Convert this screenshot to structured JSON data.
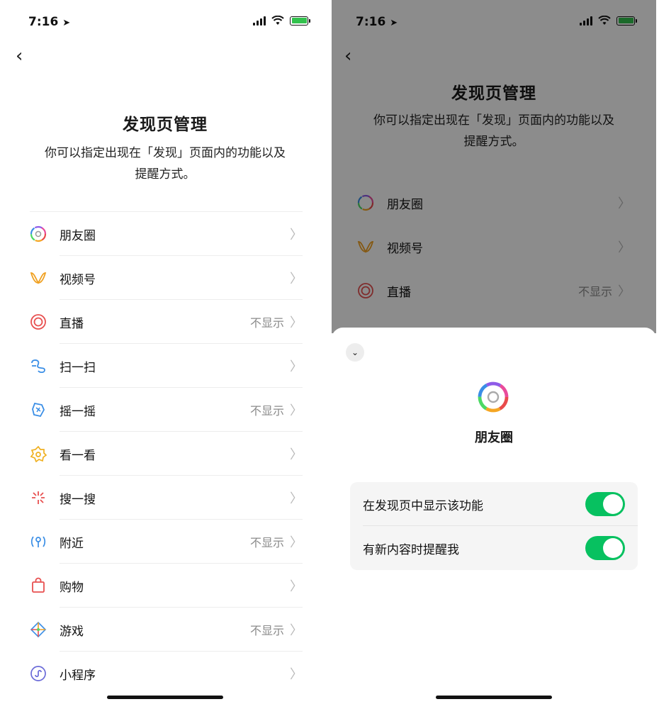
{
  "status_bar": {
    "time": "7:16",
    "battery_color": "#32c24d"
  },
  "page": {
    "title": "发现页管理",
    "subtitle_line1": "你可以指定出现在「发现」页面内的功能以及",
    "subtitle_line2": "提醒方式。"
  },
  "list": [
    {
      "label": "朋友圈",
      "value": "",
      "icon": "moments-icon"
    },
    {
      "label": "视频号",
      "value": "",
      "icon": "channels-icon"
    },
    {
      "label": "直播",
      "value": "不显示",
      "icon": "live-icon"
    },
    {
      "label": "扫一扫",
      "value": "",
      "icon": "scan-icon"
    },
    {
      "label": "摇一摇",
      "value": "不显示",
      "icon": "shake-icon"
    },
    {
      "label": "看一看",
      "value": "",
      "icon": "top-stories-icon"
    },
    {
      "label": "搜一搜",
      "value": "",
      "icon": "search-icon"
    },
    {
      "label": "附近",
      "value": "不显示",
      "icon": "nearby-icon"
    },
    {
      "label": "购物",
      "value": "",
      "icon": "shopping-icon"
    },
    {
      "label": "游戏",
      "value": "不显示",
      "icon": "games-icon"
    },
    {
      "label": "小程序",
      "value": "",
      "icon": "mini-programs-icon"
    }
  ],
  "sheet": {
    "title": "朋友圈",
    "settings": [
      {
        "label": "在发现页中显示该功能",
        "on": true
      },
      {
        "label": "有新内容时提醒我",
        "on": true
      }
    ],
    "accent": "#07c160"
  }
}
